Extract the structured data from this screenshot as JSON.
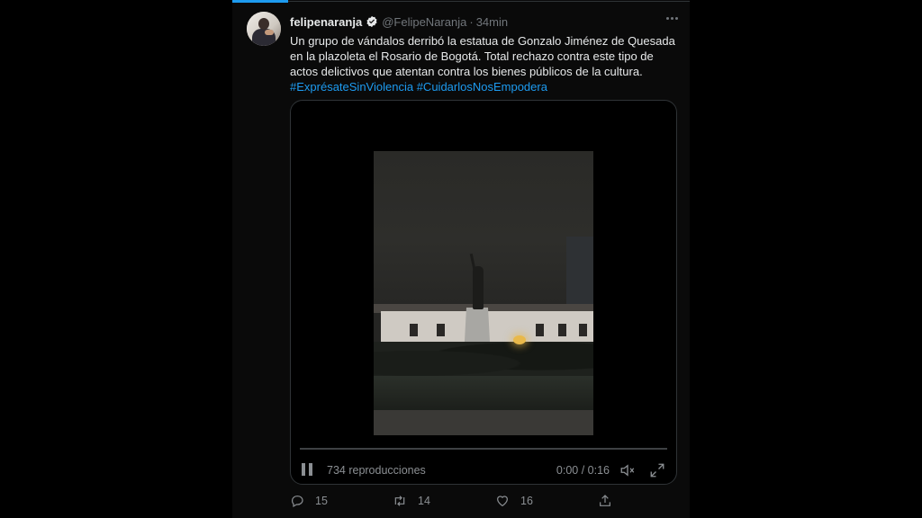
{
  "tweet": {
    "display_name": "felipenaranja",
    "handle": "@FelipeNaranja",
    "separator": "·",
    "time": "34min",
    "text_lines": [
      "Un grupo de vándalos derribó la estatua de Gonzalo Jiménez de Quesada",
      "en la plazoleta el Rosario de Bogotá. Total rechazo contra este tipo de",
      "actos delictivos que atentan contra los bienes públicos de la cultura."
    ],
    "hashtags": [
      "#ExprésateSinViolencia",
      "#CuidarlosNosEmpodera"
    ]
  },
  "video": {
    "views_label": "734 reproducciones",
    "timecode": "0:00 / 0:16",
    "progress": 0
  },
  "actions": {
    "replies": "15",
    "retweets": "14",
    "likes": "16"
  },
  "colors": {
    "accent": "#1d9bf0",
    "background": "#0a0a0a",
    "muted": "#71767b"
  },
  "icons": [
    "verified-badge-icon",
    "more-icon",
    "pause-icon",
    "volume-icon",
    "fullscreen-icon",
    "reply-icon",
    "retweet-icon",
    "like-icon",
    "share-icon"
  ]
}
